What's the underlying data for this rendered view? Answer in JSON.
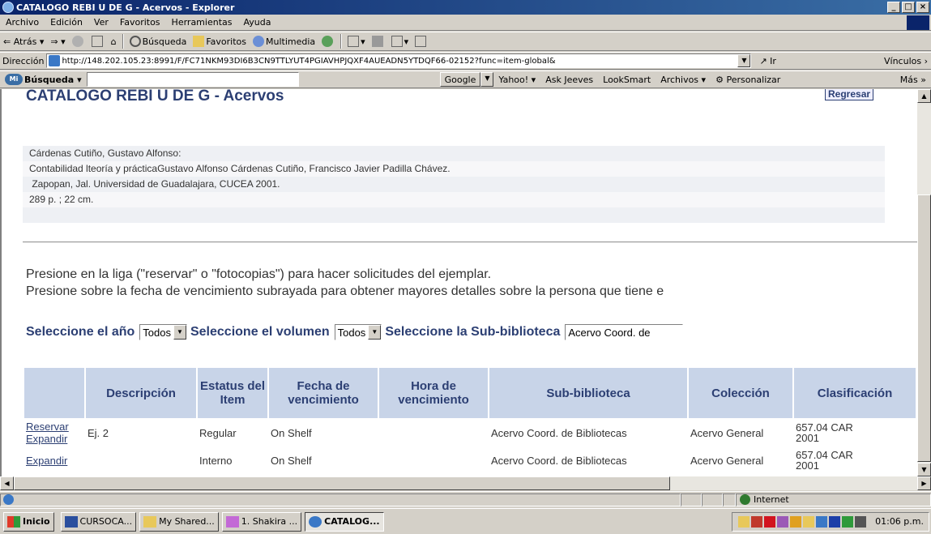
{
  "window": {
    "title": "CATALOGO REBI U DE G - Acervos - Explorer",
    "min": "_",
    "max": "□",
    "close": "×"
  },
  "menu": [
    "Archivo",
    "Edición",
    "Ver",
    "Favoritos",
    "Herramientas",
    "Ayuda"
  ],
  "toolbar": {
    "back": "Atrás",
    "search": "Búsqueda",
    "favorites": "Favoritos",
    "multimedia": "Multimedia"
  },
  "address": {
    "label": "Dirección",
    "url": "http://148.202.105.23:8991/F/FC71NKM93DI6B3CN9TTLYUT4PGIAVHPJQXF4AUEADN5YTDQF66-02152?func=item-global&",
    "go": "Ir",
    "links": "Vínculos"
  },
  "searchbar": {
    "logo": "Mi",
    "brand": "Búsqueda",
    "google": "Google",
    "items": [
      "Yahoo!",
      "Ask Jeeves",
      "LookSmart",
      "Archivos",
      "Personalizar"
    ],
    "more": "Más"
  },
  "page": {
    "title": "CATALOGO REBI U DE G - Acervos",
    "back_button": "Regresar",
    "record": [
      "Cárdenas Cutiño, Gustavo Alfonso:",
      "Contabilidad lteoría y prácticaGustavo Alfonso Cárdenas Cutiño, Francisco Javier Padilla Chávez.",
      " Zapopan, Jal. Universidad de Guadalajara, CUCEA 2001.",
      "289 p. ; 22 cm.",
      ""
    ],
    "instructions": [
      "Presione en la liga (\"reservar\" o \"fotocopias\") para hacer solicitudes del ejemplar.",
      "Presione sobre la fecha de vencimiento subrayada para obtener mayores detalles sobre la persona que tiene e"
    ],
    "filters": {
      "year_label": "Seleccione el año",
      "year_value": "Todos",
      "volume_label": "Seleccione el volumen",
      "volume_value": "Todos",
      "sublib_label": "Seleccione la Sub-biblioteca",
      "sublib_value": "Acervo Coord. de"
    },
    "table": {
      "headers": [
        "Descripción",
        "Estatus del Item",
        "Fecha de vencimiento",
        "Hora de vencimiento",
        "Sub-biblioteca",
        "Colección",
        "Clasificación"
      ],
      "rows": [
        {
          "links": [
            "Reservar",
            "Expandir"
          ],
          "descripcion": "Ej. 2",
          "estatus": "Regular",
          "fecha": "On Shelf",
          "hora": "",
          "sub": "Acervo Coord. de Bibliotecas",
          "coleccion": "Acervo General",
          "clasificacion": [
            "657.04 CAR",
            "2001"
          ]
        },
        {
          "links": [
            "Expandir"
          ],
          "descripcion": "",
          "estatus": "Interno",
          "fecha": "On Shelf",
          "hora": "",
          "sub": "Acervo Coord. de Bibliotecas",
          "coleccion": "Acervo General",
          "clasificacion": [
            "657.04 CAR",
            "2001"
          ]
        }
      ]
    }
  },
  "status": {
    "zone": "Internet"
  },
  "taskbar": {
    "start": "Inicio",
    "tasks": [
      "CURSOCA...",
      "My Shared...",
      "1. Shakira ...",
      "CATALOG..."
    ],
    "clock": "01:06 p.m."
  },
  "colors": {
    "accent": "#2c3f73",
    "header_bg": "#c8d4e8",
    "titlebar": "#0a246a"
  }
}
